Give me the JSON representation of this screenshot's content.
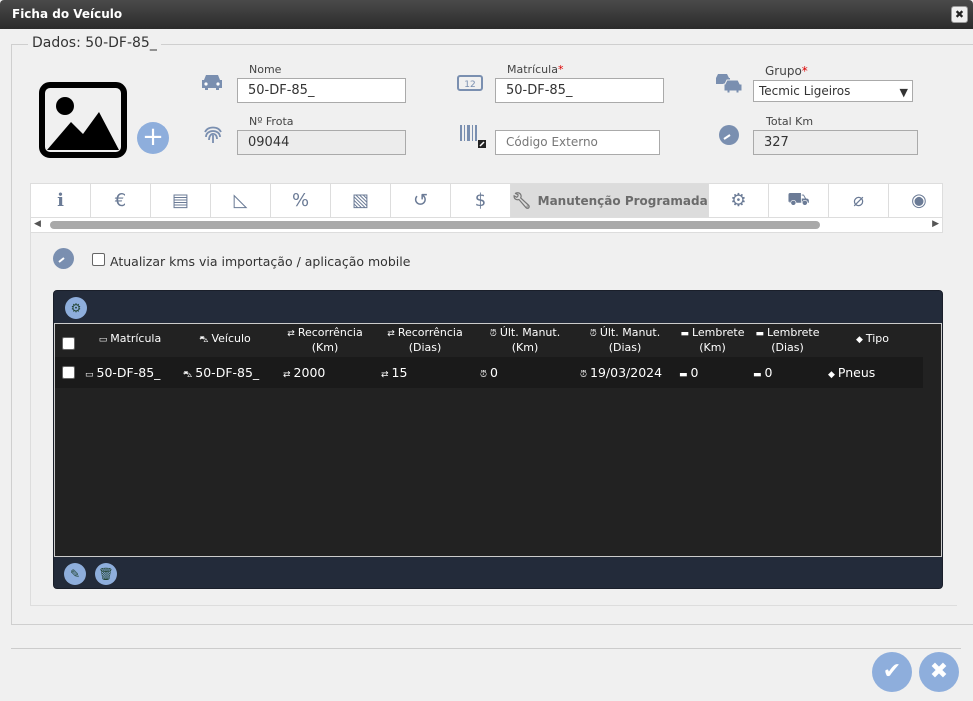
{
  "window": {
    "title": "Ficha do Veículo"
  },
  "legend": "Dados: 50-DF-85_",
  "fields": {
    "nome": {
      "label": "Nome",
      "value": "50-DF-85_"
    },
    "matricula": {
      "label": "Matrícula",
      "required": "*",
      "value": "50-DF-85_"
    },
    "grupo": {
      "label": "Grupo",
      "required": "*",
      "value": "Tecmic Ligeiros"
    },
    "frota": {
      "label": "Nº Frota",
      "value": "09044"
    },
    "codigo_externo": {
      "placeholder": "Código Externo"
    },
    "total_km": {
      "label": "Total Km",
      "value": "327"
    }
  },
  "tabs": {
    "active_label": "Manutenção Programada",
    "icons": [
      "info-icon",
      "euro-icon",
      "book-icon",
      "ruler-icon",
      "percent-icon",
      "document-icon",
      "history-icon",
      "dollar-icon",
      "wrench-icon",
      "gear-icon",
      "car-lift-icon",
      "paperclip-icon",
      "toggle-icon"
    ]
  },
  "options": {
    "update_kms_label": "Atualizar kms via importação / aplicação mobile",
    "update_kms_checked": false
  },
  "grid": {
    "columns": [
      {
        "label": "Matrícula"
      },
      {
        "label": "Veículo"
      },
      {
        "label": "Recorrência (Km)"
      },
      {
        "label": "Recorrência (Dias)"
      },
      {
        "label": "Últ. Manut. (Km)"
      },
      {
        "label": "Últ. Manut. (Dias)"
      },
      {
        "label": "Lembrete (Km)"
      },
      {
        "label": "Lembrete (Dias)"
      },
      {
        "label": "Tipo"
      }
    ],
    "rows": [
      {
        "matricula": "50-DF-85_",
        "veiculo": "50-DF-85_",
        "rec_km": "2000",
        "rec_dias": "15",
        "ult_km": "0",
        "ult_dias": "19/03/2024",
        "lemb_km": "0",
        "lemb_dias": "0",
        "tipo": "Pneus"
      }
    ]
  },
  "colors": {
    "accent": "#8eaedc",
    "grid_bg": "#232b3a",
    "titlebar": "#3a3a3a"
  }
}
